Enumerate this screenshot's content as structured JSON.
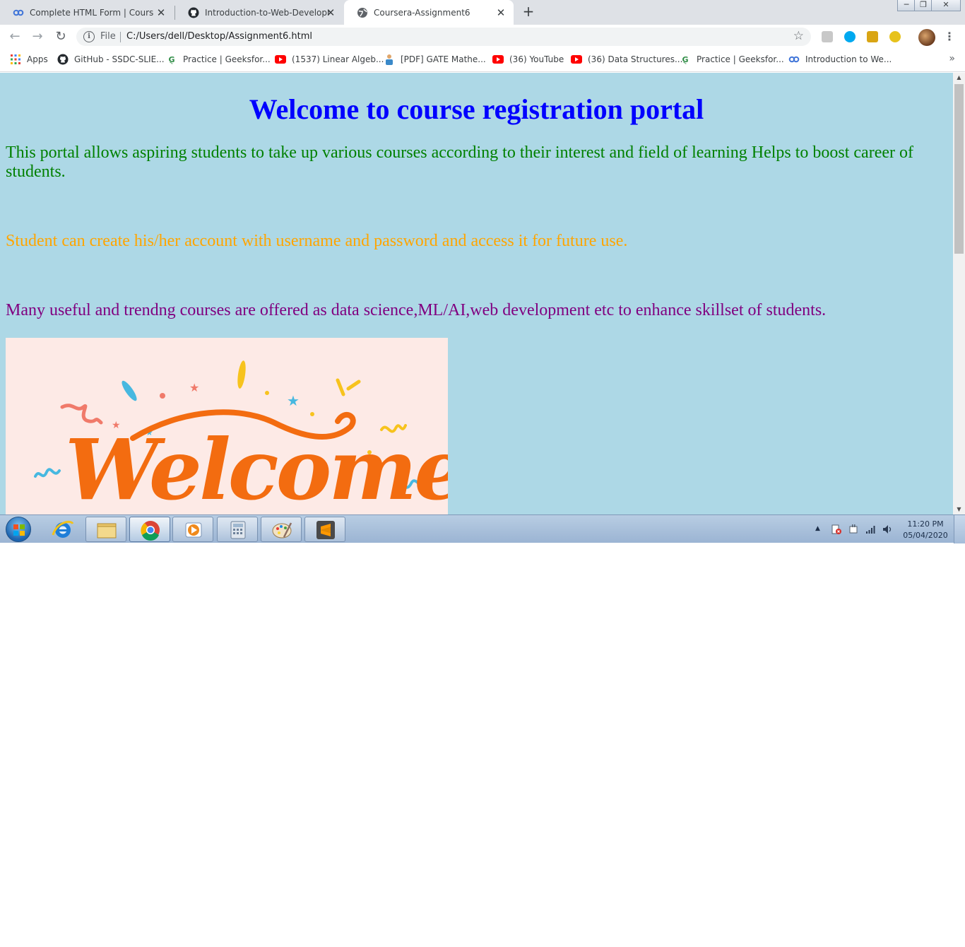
{
  "browser": {
    "tabs": [
      {
        "title": "Complete HTML Form | Coursera",
        "icon": "coursera-icon"
      },
      {
        "title": "Introduction-to-Web-Developme",
        "icon": "github-icon"
      },
      {
        "title": "Coursera-Assignment6",
        "icon": "globe-icon"
      }
    ],
    "close_glyph": "✕",
    "new_tab_glyph": "+",
    "address": {
      "scheme_label": "File",
      "url": "C:/Users/dell/Desktop/Assignment6.html"
    },
    "bookmarks": [
      {
        "label": "Apps",
        "icon": "apps-grid-icon"
      },
      {
        "label": "GitHub - SSDC-SLIE...",
        "icon": "github-icon"
      },
      {
        "label": "Practice | Geeksfor...",
        "icon": "geeksforgeeks-icon"
      },
      {
        "label": "(1537) Linear Algeb...",
        "icon": "youtube-icon"
      },
      {
        "label": "[PDF] GATE Mathe...",
        "icon": "person-icon"
      },
      {
        "label": "(36) YouTube",
        "icon": "youtube-icon"
      },
      {
        "label": "(36) Data Structures...",
        "icon": "youtube-icon"
      },
      {
        "label": "Practice | Geeksfor...",
        "icon": "geeksforgeeks-icon"
      },
      {
        "label": "Introduction to We...",
        "icon": "coursera-icon"
      }
    ],
    "more_glyph": "»"
  },
  "page": {
    "heading": "Welcome to course registration portal",
    "intro": "This portal allows aspiring students to take up various courses according to their interest and field of learning Helps to boost career of students.",
    "account": "Student can create his/her account with username and password and access it for future use.",
    "courses": "Many useful and trendng courses are offered as data science,ML/AI,web development etc to enhance skillset of students.",
    "image_text": "Welcome"
  },
  "taskbar": {
    "apps": [
      "internet-explorer",
      "file-explorer",
      "chrome",
      "media-player",
      "calculator",
      "paint",
      "sublime-text"
    ],
    "clock_time": "11:20 PM",
    "clock_date": "05/04/2020"
  },
  "colors": {
    "page_background": "#add8e6",
    "heading": "#0000ff",
    "intro": "#008000",
    "account": "#ffa500",
    "courses": "#800080",
    "welcome_lettering": "#f36c10"
  }
}
